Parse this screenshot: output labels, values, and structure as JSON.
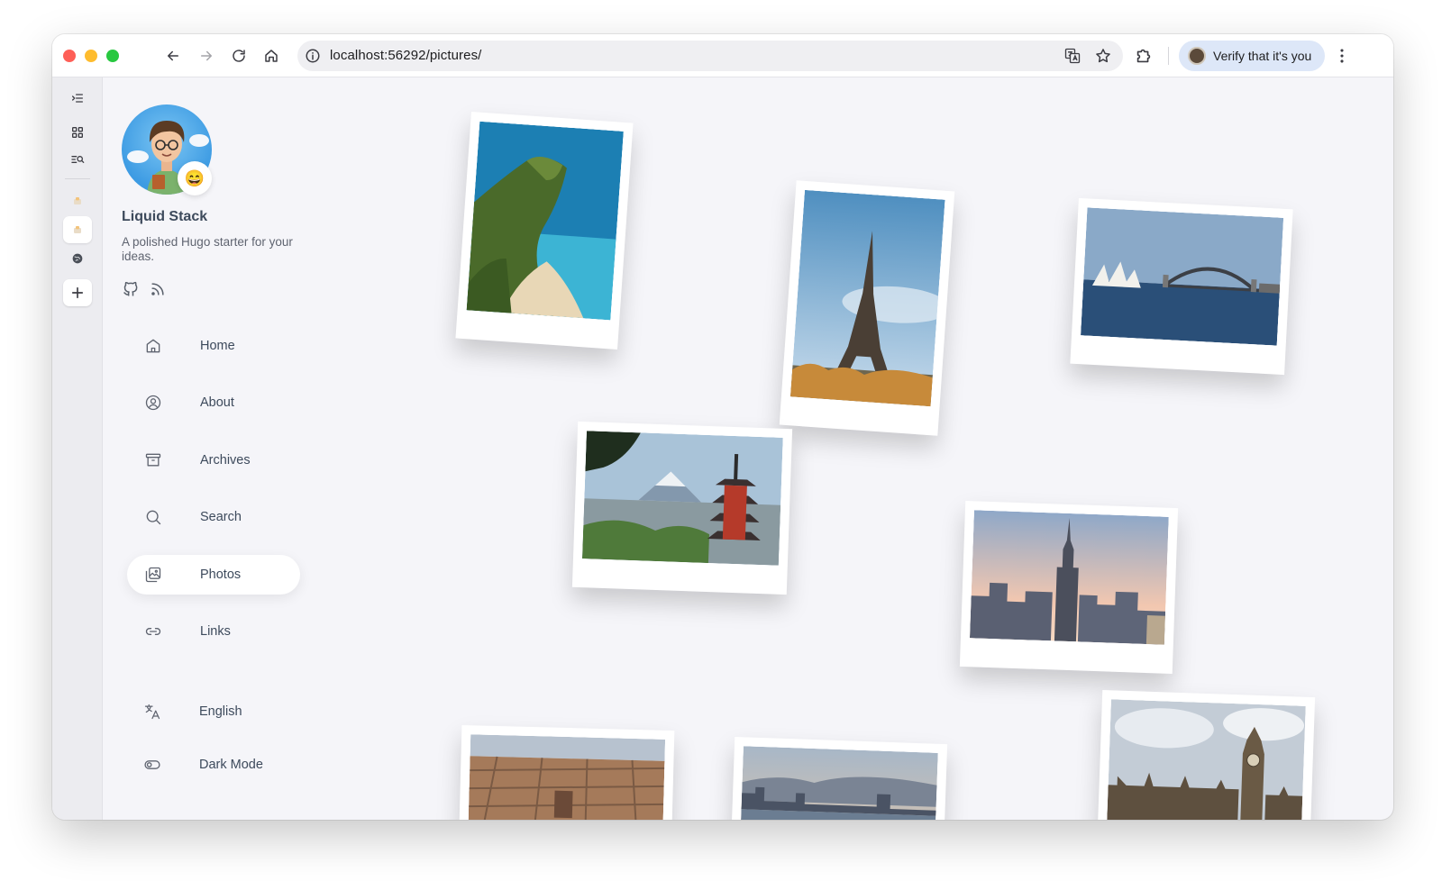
{
  "browser": {
    "url": "localhost:56292/pictures/",
    "profile_label": "Verify that it's you"
  },
  "site": {
    "title": "Liquid Stack",
    "description": "A polished Hugo starter for your ideas.",
    "emoji": "😄"
  },
  "nav": {
    "items": [
      {
        "label": "Home",
        "icon": "home-icon"
      },
      {
        "label": "About",
        "icon": "user-circle-icon"
      },
      {
        "label": "Archives",
        "icon": "archive-icon"
      },
      {
        "label": "Search",
        "icon": "search-icon"
      },
      {
        "label": "Photos",
        "icon": "photos-icon",
        "active": true
      },
      {
        "label": "Links",
        "icon": "link-icon"
      }
    ],
    "language_label": "English",
    "dark_mode_label": "Dark Mode"
  },
  "photos": [
    {
      "subject": "coastal cliff"
    },
    {
      "subject": "eiffel tower"
    },
    {
      "subject": "sydney harbour"
    },
    {
      "subject": "pagoda and mount fuji"
    },
    {
      "subject": "empire state building"
    },
    {
      "subject": "barcelona aerial"
    },
    {
      "subject": "harbour skyline at dusk"
    },
    {
      "subject": "big ben"
    }
  ]
}
